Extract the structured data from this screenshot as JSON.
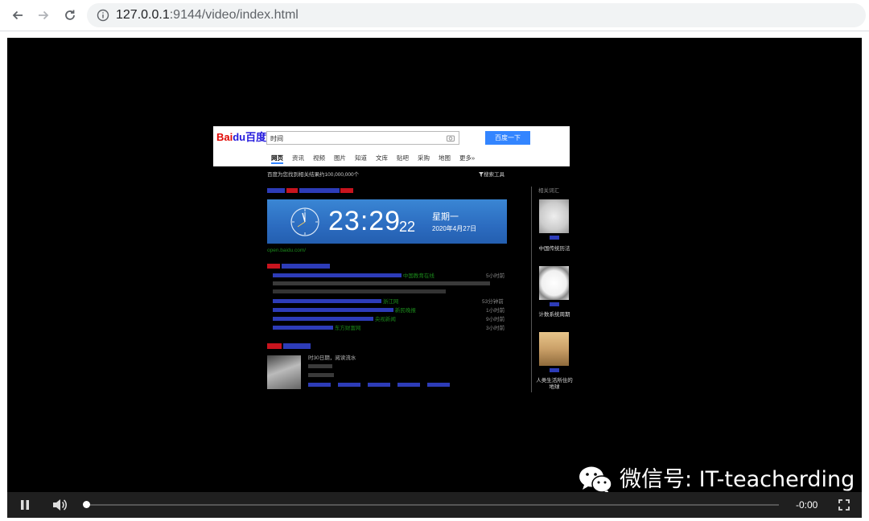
{
  "browser": {
    "url_host": "127.0.0.1",
    "url_rest": ":9144/video/index.html"
  },
  "baidu": {
    "logo_bai": "Bai",
    "logo_du": "du百度",
    "query": "时间",
    "search_button": "百度一下",
    "tabs": [
      "网页",
      "资讯",
      "视频",
      "图片",
      "知道",
      "文库",
      "贴吧",
      "采购",
      "地图",
      "更多»"
    ],
    "result_count": "百度为您找到相关结果约100,000,000个",
    "tools": "搜索工具",
    "clock": {
      "time": "23:29",
      "seconds": "22",
      "weekday": "星期一",
      "date": "2020年4月27日"
    },
    "source": "open.baidu.com/",
    "related_title": "相关词汇",
    "related": [
      {
        "caption": "中国传统历法"
      },
      {
        "caption": "计数系统周期"
      },
      {
        "caption": "人类生活所住的地球"
      }
    ],
    "news": [
      {
        "time": "5小时前"
      },
      {
        "time": "53分钟前"
      },
      {
        "time": "1小时前"
      },
      {
        "time": "9小时前"
      },
      {
        "time": "3小时前"
      }
    ],
    "news_sources": [
      "中国教育在线",
      "浙江网",
      "新民晚报",
      "央视新闻",
      "东方财富网"
    ],
    "video_info": [
      "时30日期，阅读流水"
    ]
  },
  "watermark": {
    "text": "微信号: IT-teacherding"
  },
  "player": {
    "time_remaining": "-0:00",
    "progress_percent": 0
  }
}
